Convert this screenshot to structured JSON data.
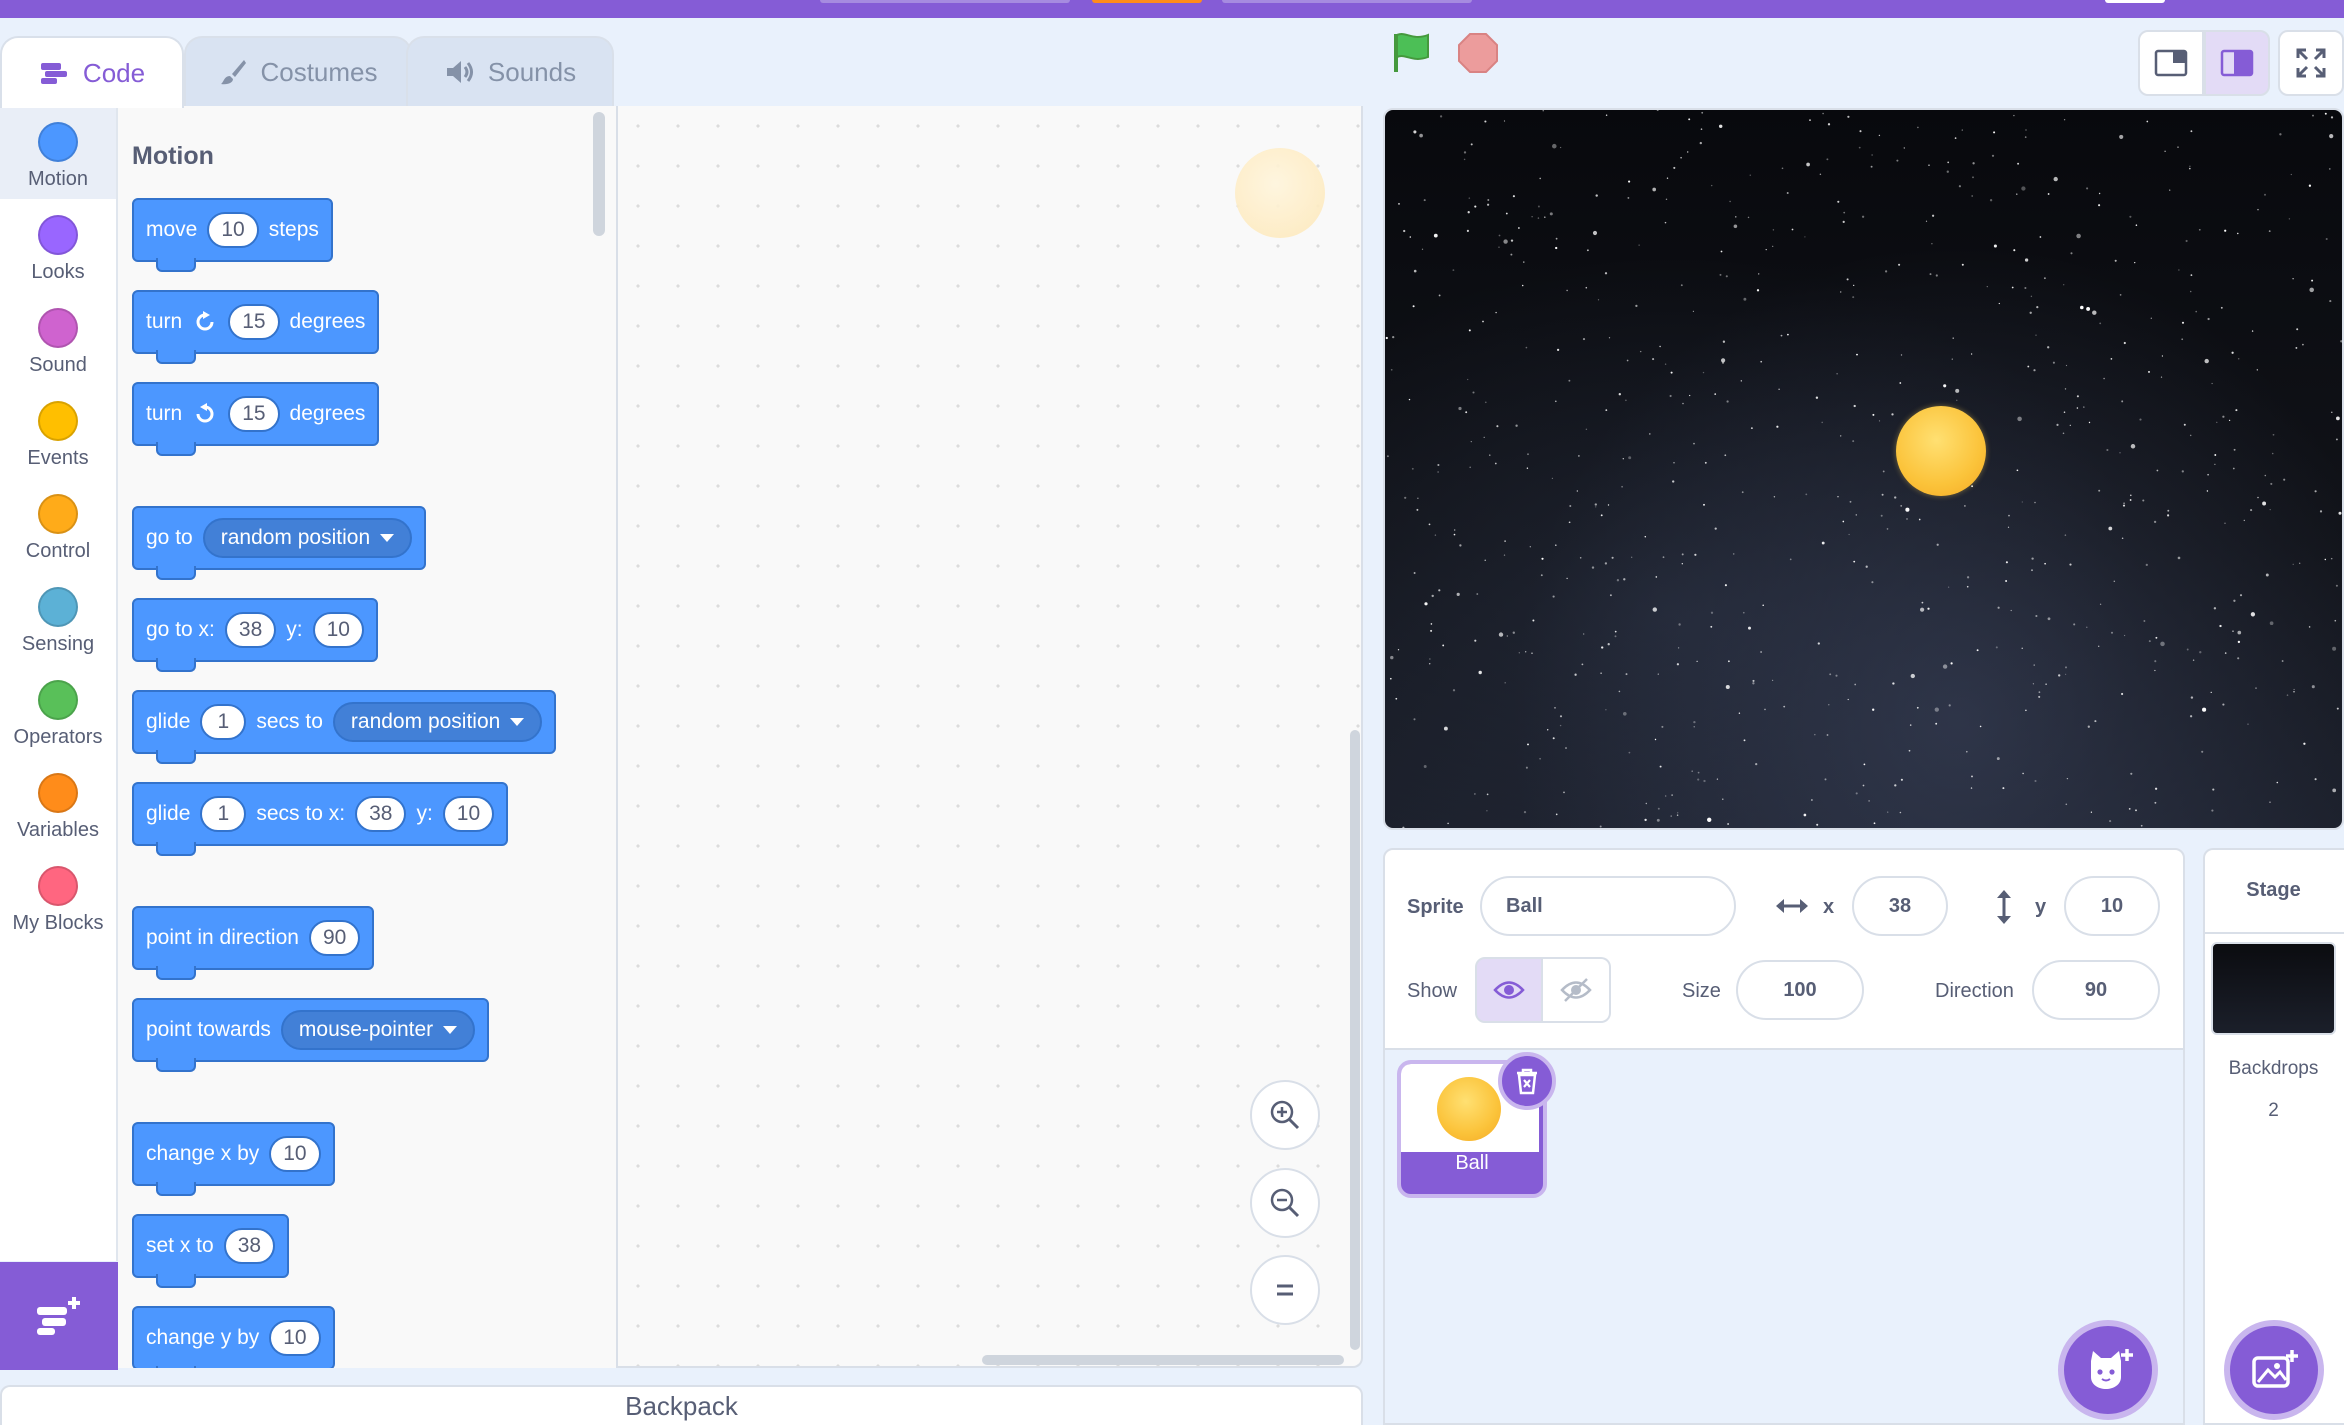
{
  "tabs": [
    {
      "label": "Code",
      "icon": "code-icon"
    },
    {
      "label": "Costumes",
      "icon": "brush-icon"
    },
    {
      "label": "Sounds",
      "icon": "speaker-icon"
    }
  ],
  "categories": [
    {
      "label": "Motion",
      "color": "#4c97ff"
    },
    {
      "label": "Looks",
      "color": "#9966ff"
    },
    {
      "label": "Sound",
      "color": "#cf63cf"
    },
    {
      "label": "Events",
      "color": "#ffbf00"
    },
    {
      "label": "Control",
      "color": "#ffab19"
    },
    {
      "label": "Sensing",
      "color": "#5cb1d6"
    },
    {
      "label": "Operators",
      "color": "#59c059"
    },
    {
      "label": "Variables",
      "color": "#ff8c1a"
    },
    {
      "label": "My Blocks",
      "color": "#ff6680"
    }
  ],
  "palette": {
    "title": "Motion",
    "blocks": {
      "move": {
        "pre": "move",
        "value": "10",
        "post": "steps"
      },
      "turn_right": {
        "pre": "turn",
        "value": "15",
        "post": "degrees"
      },
      "turn_left": {
        "pre": "turn",
        "value": "15",
        "post": "degrees"
      },
      "go_to": {
        "pre": "go to",
        "option": "random position"
      },
      "go_to_xy": {
        "pre": "go to x:",
        "x": "38",
        "mid": "y:",
        "y": "10"
      },
      "glide_to": {
        "pre": "glide",
        "secs": "1",
        "mid": "secs to",
        "option": "random position"
      },
      "glide_to_xy": {
        "pre": "glide",
        "secs": "1",
        "mid": "secs to x:",
        "x": "38",
        "mid2": "y:",
        "y": "10"
      },
      "point_direction": {
        "pre": "point in direction",
        "value": "90"
      },
      "point_towards": {
        "pre": "point towards",
        "option": "mouse-pointer"
      },
      "change_x": {
        "pre": "change x by",
        "value": "10"
      },
      "set_x": {
        "pre": "set x to",
        "value": "38"
      },
      "change_y": {
        "pre": "change y by",
        "value": "10"
      }
    }
  },
  "backpack": {
    "label": "Backpack"
  },
  "sprite_info": {
    "sprite_label": "Sprite",
    "sprite_name": "Ball",
    "x_label": "x",
    "x_value": "38",
    "y_label": "y",
    "y_value": "10",
    "show_label": "Show",
    "size_label": "Size",
    "size_value": "100",
    "direction_label": "Direction",
    "direction_value": "90"
  },
  "sprites": [
    {
      "name": "Ball"
    }
  ],
  "stage_target": {
    "title": "Stage",
    "backdrops_label": "Backdrops",
    "backdrops_count": "2"
  },
  "colors": {
    "accent": "#855cd6",
    "motion": "#4c97ff",
    "motion_border": "#3373cc"
  }
}
